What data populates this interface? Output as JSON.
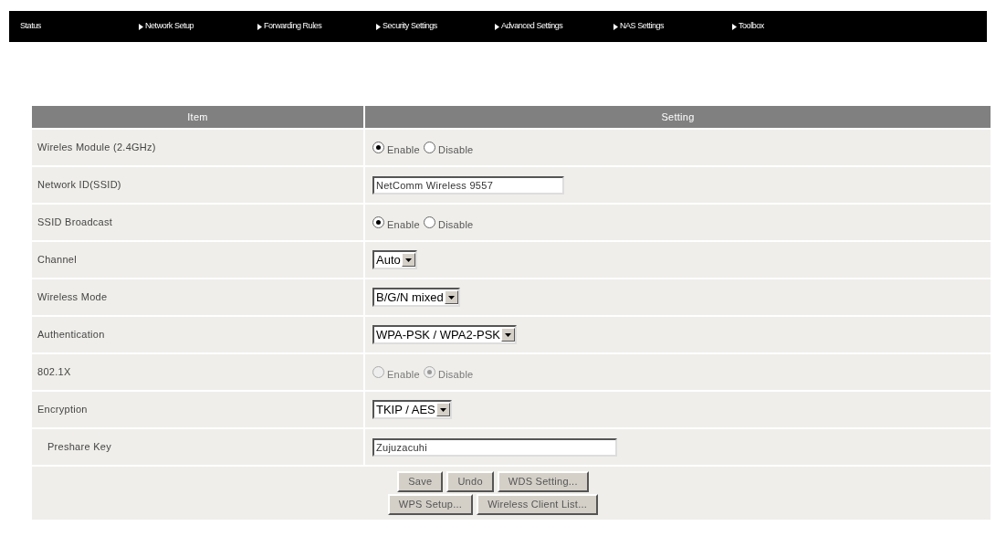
{
  "nav": [
    {
      "label": "Status",
      "arrow": false
    },
    {
      "label": "Network Setup",
      "arrow": true
    },
    {
      "label": "Forwarding Rules",
      "arrow": true
    },
    {
      "label": "Security Settings",
      "arrow": true
    },
    {
      "label": "Advanced Settings",
      "arrow": true
    },
    {
      "label": "NAS Settings",
      "arrow": true
    },
    {
      "label": "Toolbox",
      "arrow": true
    }
  ],
  "table": {
    "columns": [
      "Item",
      "Setting"
    ],
    "rows": [
      {
        "label": "Wireles Module (2.4GHz)",
        "kind": "radio",
        "disabled": false,
        "options": [
          {
            "label": "Enable",
            "selected": true
          },
          {
            "label": "Disable",
            "selected": false
          }
        ]
      },
      {
        "label": "Network ID(SSID)",
        "kind": "text",
        "value": "NetComm Wireless 9557",
        "wide": false
      },
      {
        "label": "SSID Broadcast",
        "kind": "radio",
        "disabled": false,
        "options": [
          {
            "label": "Enable",
            "selected": true
          },
          {
            "label": "Disable",
            "selected": false
          }
        ]
      },
      {
        "label": "Channel",
        "kind": "select",
        "value": "Auto"
      },
      {
        "label": "Wireless Mode",
        "kind": "select",
        "value": "B/G/N mixed"
      },
      {
        "label": "Authentication",
        "kind": "select",
        "value": "WPA-PSK / WPA2-PSK"
      },
      {
        "label": "802.1X",
        "kind": "radio",
        "disabled": true,
        "options": [
          {
            "label": "Enable",
            "selected": false
          },
          {
            "label": "Disable",
            "selected": true
          }
        ]
      },
      {
        "label": "Encryption",
        "kind": "select",
        "value": "TKIP / AES",
        "children": [
          {
            "label": "Preshare Key",
            "kind": "text",
            "value": "Zujuzacuhi",
            "wide": true
          }
        ]
      }
    ],
    "buttons": [
      [
        "Save",
        "Undo",
        "WDS Setting..."
      ],
      [
        "WPS Setup...",
        "Wireless Client List..."
      ]
    ]
  }
}
